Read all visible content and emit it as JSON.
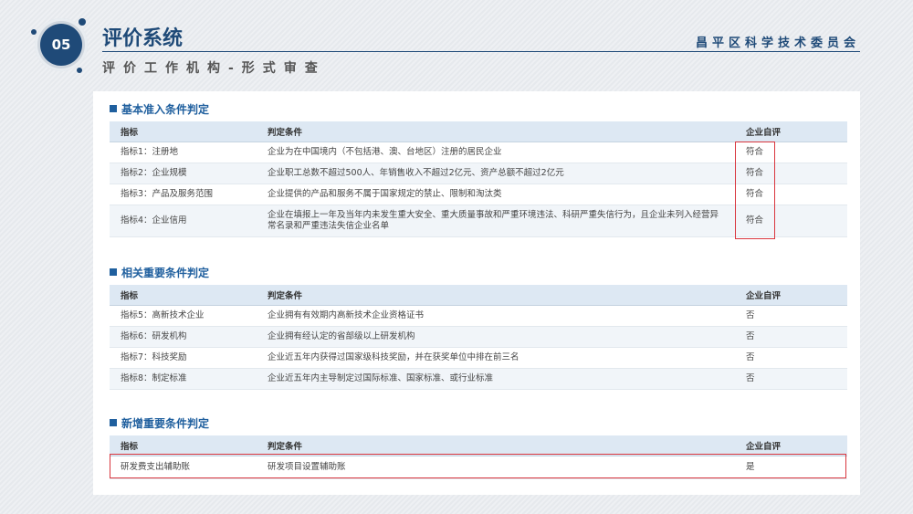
{
  "header": {
    "badge_number": "05",
    "title": "评价系统",
    "organization": "昌平区科学技术委员会",
    "subtitle": "评价工作机构-形式审查"
  },
  "sections": [
    {
      "title": "基本准入条件判定",
      "columns": [
        "指标",
        "判定条件",
        "企业自评"
      ],
      "rows": [
        [
          "指标1：注册地",
          "企业为在中国境内（不包括港、澳、台地区）注册的居民企业",
          "符合"
        ],
        [
          "指标2：企业规模",
          "企业职工总数不超过500人、年销售收入不超过2亿元、资产总额不超过2亿元",
          "符合"
        ],
        [
          "指标3：产品及服务范围",
          "企业提供的产品和服务不属于国家规定的禁止、限制和淘汰类",
          "符合"
        ],
        [
          "指标4：企业信用",
          "企业在填报上一年及当年内未发生重大安全、重大质量事故和严重环境违法、科研严重失信行为，且企业未列入经营异常名录和严重违法失信企业名单",
          "符合"
        ]
      ]
    },
    {
      "title": "相关重要条件判定",
      "columns": [
        "指标",
        "判定条件",
        "企业自评"
      ],
      "rows": [
        [
          "指标5：高新技术企业",
          "企业拥有有效期内高新技术企业资格证书",
          "否"
        ],
        [
          "指标6：研发机构",
          "企业拥有经认定的省部级以上研发机构",
          "否"
        ],
        [
          "指标7：科技奖励",
          "企业近五年内获得过国家级科技奖励，并在获奖单位中排在前三名",
          "否"
        ],
        [
          "指标8：制定标准",
          "企业近五年内主导制定过国际标准、国家标准、或行业标准",
          "否"
        ]
      ]
    },
    {
      "title": "新增重要条件判定",
      "columns": [
        "指标",
        "判定条件",
        "企业自评"
      ],
      "rows": [
        [
          "研发费支出辅助账",
          "研发项目设置辅助账",
          "是"
        ]
      ]
    }
  ],
  "colors": {
    "brand": "#1f4a78",
    "section_title": "#1f5f9e",
    "highlight": "#d9363e",
    "table_header_bg": "#dde8f3"
  }
}
